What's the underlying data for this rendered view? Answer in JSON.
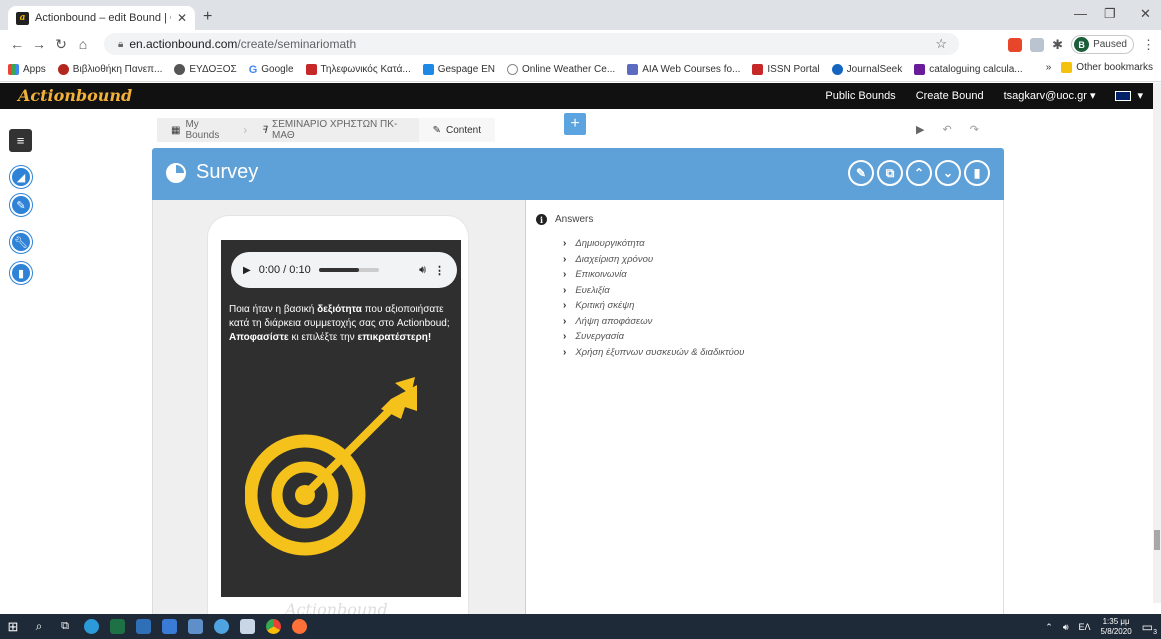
{
  "browser": {
    "tab_title": "Actionbound – edit Bound | Crea",
    "url_host": "en.actionbound.com",
    "url_path": "/create/seminariomath",
    "profile_initial": "B",
    "profile_status": "Paused"
  },
  "bookmarks": {
    "items": [
      "Apps",
      "Βιβλιοθήκη Πανεπ...",
      "ΕΥΔΟΞΟΣ",
      "Google",
      "Τηλεφωνικός Κατά...",
      "Gespage EN",
      "Online Weather Ce...",
      "AIA Web Courses fo...",
      "ISSN Portal",
      "JournalSeek",
      "cataloguing calcula..."
    ],
    "more": "»",
    "other": "Other bookmarks"
  },
  "app": {
    "logo": "Actionbound",
    "nav": [
      "Public Bounds",
      "Create Bound",
      "tsagkarv@uoc.gr"
    ]
  },
  "breadcrumb": {
    "items": [
      "My Bounds",
      "ΣΕΜΙΝΑΡΙΟ ΧΡΗΣΤΩΝ ΠΚ-ΜΑΘ",
      "Content"
    ]
  },
  "panel": {
    "title": "Survey"
  },
  "audio": {
    "time": "0:00 / 0:10"
  },
  "question": {
    "part1": "Ποια ήταν η βασική ",
    "bold1": "δεξιότητα",
    "part2": " που αξιοποιήσατε κατά τη διάρκεια συμμετοχής σας στο Actionboud; ",
    "bold2": "Αποφασίστε",
    "part3": " κι επιλέξτε την ",
    "bold3": "επικρατέστερη!"
  },
  "phone_footer": "Actionbound",
  "answers": {
    "heading": "Answers",
    "items": [
      "Δημιουργικότητα",
      "Διαχείριση χρόνου",
      "Επικοινωνία",
      "Ευελιξία",
      "Κριτική σκέψη",
      "Λήψη αποφάσεων",
      "Συνεργασία",
      "Χρήση έξυπνων συσκευών & διαδικτύου"
    ]
  },
  "taskbar": {
    "lang": "ΕΛ",
    "time": "1:35 μμ",
    "date": "5/8/2020",
    "notifications": "3"
  },
  "colors": {
    "panel": "#5ea0d8",
    "rail": "#2f83d6",
    "logo": "#f2b138",
    "target": "#f5c21b"
  }
}
